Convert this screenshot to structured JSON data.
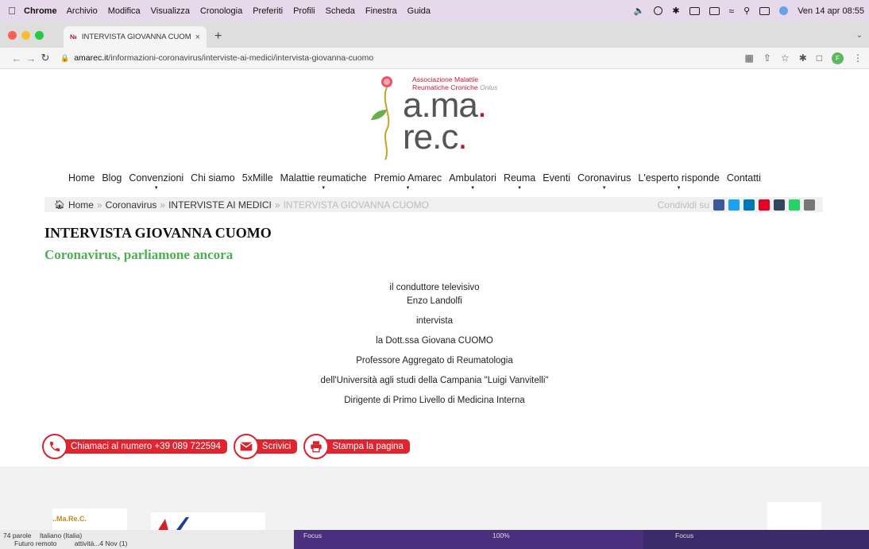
{
  "menubar": {
    "app": "Chrome",
    "items": [
      "Archivio",
      "Modifica",
      "Visualizza",
      "Cronologia",
      "Preferiti",
      "Profili",
      "Scheda",
      "Finestra",
      "Guida"
    ],
    "clock": "Ven 14 apr 08:55"
  },
  "browser": {
    "tab_title": "INTERVISTA GIOVANNA CUOM",
    "url_domain": "amarec.it",
    "url_path": "/informazioni-coronavirus/interviste-ai-medici/intervista-giovanna-cuomo",
    "profile_initial": "F"
  },
  "logo": {
    "assoc_line1_a": "Associazione ",
    "assoc_line1_b": "Malattie",
    "assoc_line2_a": "Reumatiche Croniche ",
    "assoc_line2_b": "Onlus",
    "l1_a": "a.ma",
    "l1_b": ".",
    "l2_a": "re.c",
    "l2_b": "."
  },
  "nav": [
    {
      "label": "Home",
      "dropdown": false
    },
    {
      "label": "Blog",
      "dropdown": false
    },
    {
      "label": "Convenzioni",
      "dropdown": true
    },
    {
      "label": "Chi siamo",
      "dropdown": false
    },
    {
      "label": "5xMille",
      "dropdown": false
    },
    {
      "label": "Malattie reumatiche",
      "dropdown": true
    },
    {
      "label": "Premio Amarec",
      "dropdown": true
    },
    {
      "label": "Ambulatori",
      "dropdown": true
    },
    {
      "label": "Reuma",
      "dropdown": true
    },
    {
      "label": "Eventi",
      "dropdown": false
    },
    {
      "label": "Coronavirus",
      "dropdown": true
    },
    {
      "label": "L'esperto risponde",
      "dropdown": true
    },
    {
      "label": "Contatti",
      "dropdown": false
    }
  ],
  "breadcrumb": {
    "home": "Home",
    "sep": "»",
    "c1": "Coronavirus",
    "c2": "INTERVISTE AI MEDICI",
    "current": "INTERVISTA GIOVANNA CUOMO",
    "share_label": "Condividi su"
  },
  "share_colors": [
    "#3b5998",
    "#1da1f2",
    "#0077b5",
    "#e60023",
    "#35465c",
    "#25d366",
    "#777777"
  ],
  "article": {
    "title": "INTERVISTA GIOVANNA CUOMO",
    "subtitle": "Coronavirus, parliamone ancora",
    "l1": "il conduttore televisivo",
    "l2": "Enzo Landolfi",
    "l3": "intervista",
    "l4": "la Dott.ssa Giovana CUOMO",
    "l5": "Professore Aggregato di Reumatologia",
    "l6": "dell'Università agli studi della Campania \"Luigi Vanvitelli\"",
    "l7": "Dirigente di Primo Livello di Medicina Interna"
  },
  "actions": {
    "call": "Chiamaci al numero +39 089 722594",
    "write": "Scrivici",
    "print": "Stampa la pagina"
  },
  "footer": {
    "logo1_text": "..Ma.Re.C."
  },
  "strip": {
    "word_count": "74 parole",
    "language": "Italiano (Italia)",
    "row2a": "Futuro remoto",
    "row2b": "attività...4 Nov (1)",
    "focus": "Focus",
    "zoom": "100%"
  }
}
